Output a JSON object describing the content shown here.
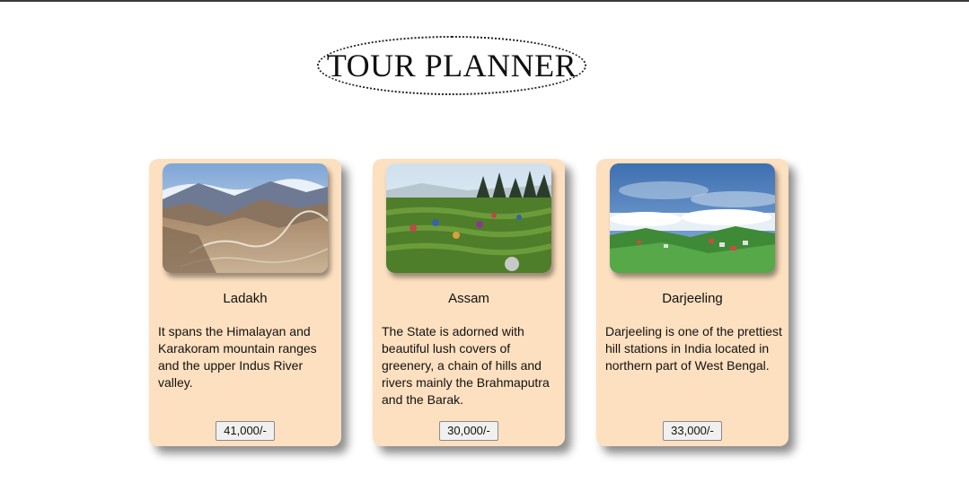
{
  "page": {
    "title": "TOUR PLANNER"
  },
  "cards": [
    {
      "name": "Ladakh",
      "description": "It spans the Himalayan and Karakoram mountain ranges and the upper Indus River valley.",
      "price": "41,000/-",
      "image": "mountain-valley-image"
    },
    {
      "name": "Assam",
      "description": "The State is adorned with beautiful lush covers of greenery, a chain of hills and rivers mainly the Brahmaputra and the Barak.",
      "price": "30,000/-",
      "image": "tea-garden-image"
    },
    {
      "name": "Darjeeling",
      "description": "Darjeeling is one of the prettiest hill stations in India located in northern part of West Bengal.",
      "price": "33,000/-",
      "image": "hill-station-image"
    }
  ],
  "colors": {
    "card_background": "#fde0c0",
    "page_background": "#ffffff",
    "title_border": "#222222"
  }
}
